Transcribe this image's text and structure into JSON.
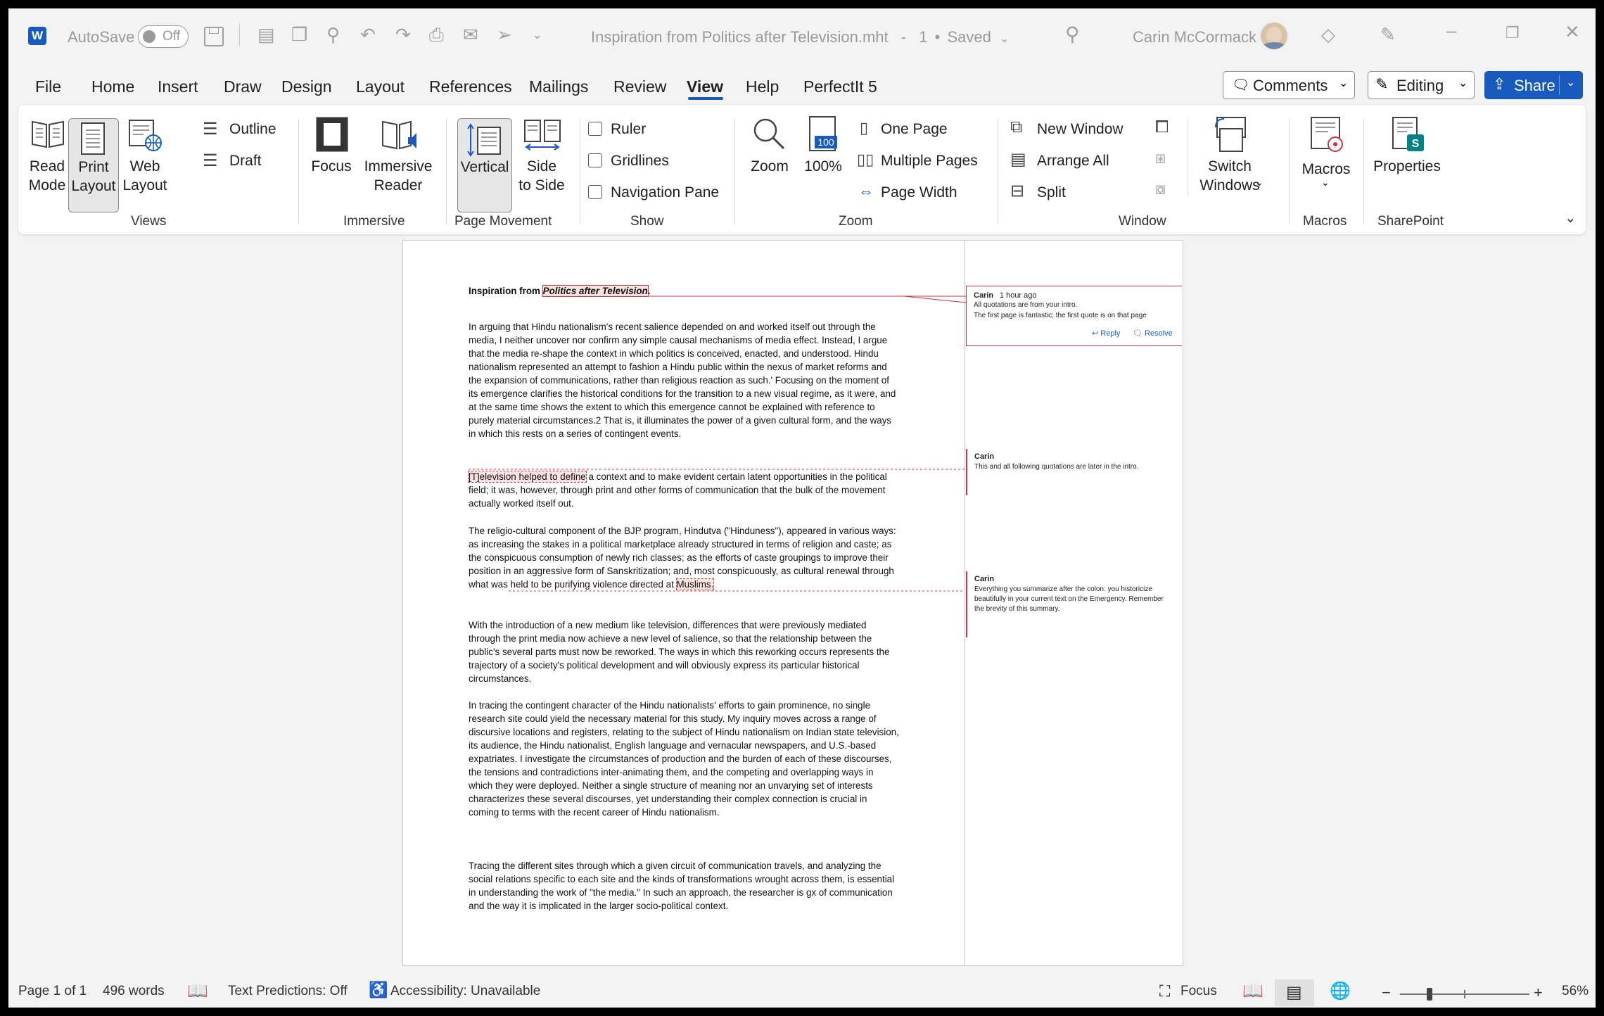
{
  "titlebar": {
    "autosave_label": "AutoSave",
    "autosave_state": "Off",
    "doc_title": "Inspiration from Politics after Television.mht",
    "sep": "-",
    "version": "1",
    "dot": "•",
    "status": "Saved",
    "user_name": "Carin McCormack"
  },
  "menu": {
    "tabs": [
      "File",
      "Home",
      "Insert",
      "Draw",
      "Design",
      "Layout",
      "References",
      "Mailings",
      "Review",
      "View",
      "Help",
      "PerfectIt 5"
    ],
    "active": "View",
    "comments_label": "Comments",
    "editing_label": "Editing",
    "share_label": "Share"
  },
  "ribbon": {
    "views": {
      "read_mode": "Read\nMode",
      "print_layout": "Print\nLayout",
      "web_layout": "Web\nLayout",
      "outline": "Outline",
      "draft": "Draft",
      "group": "Views"
    },
    "immersive": {
      "focus": "Focus",
      "reader": "Immersive\nReader",
      "group": "Immersive"
    },
    "page_movement": {
      "vertical": "Vertical",
      "side": "Side\nto Side",
      "group": "Page Movement"
    },
    "show": {
      "ruler": "Ruler",
      "gridlines": "Gridlines",
      "nav_pane": "Navigation Pane",
      "group": "Show"
    },
    "zoom": {
      "zoom": "Zoom",
      "hundred": "100%",
      "hundred_icon": "100",
      "one_page": "One Page",
      "multiple_pages": "Multiple Pages",
      "page_width": "Page Width",
      "group": "Zoom"
    },
    "window": {
      "new_window": "New Window",
      "arrange_all": "Arrange All",
      "split": "Split",
      "switch_windows": "Switch\nWindows",
      "group": "Window"
    },
    "macros": {
      "macros": "Macros",
      "group": "Macros"
    },
    "sharepoint": {
      "properties": "Properties",
      "group": "SharePoint"
    }
  },
  "document": {
    "title_prefix": "Inspiration from ",
    "title_italic": "Politics after Television",
    "title_end": ".",
    "p1": "In arguing that Hindu nationalism's recent salience depended on and worked itself out through the media, I neither uncover nor confirm any simple causal mechanisms of media effect. Instead, I argue that the media re-shape the context in which politics is conceived, enacted, and understood. Hindu nationalism represented an attempt to fashion a Hindu public within the nexus of market reforms and the expansion of communications, rather than religious reaction as such.' Focusing on the moment of its emergence clarifies the historical conditions for the transition to a new visual regime, as it were, and at the same time shows the extent to which this emergence cannot be explained with reference to purely material circumstances.2 That is, it illuminates the power of a given cultural form, and the ways in which this rests on a series of contingent events.",
    "p2_highlight": "[T]elevision helped to define",
    "p2_rest": " a context and to make evident certain latent opportunities in the political field; it was, however, through print and other forms of communication that the bulk of the movement actually worked itself out.",
    "p3_main": "The religio-cultural component of the BJP program, Hindutva (\"Hinduness\"), appeared in various ways: as increasing the stakes in a political marketplace already structured in terms of religion and caste; as the conspicuous consumption of newly rich classes; as the efforts of caste groupings to improve their position in an aggressive form of Sanskritization; and, most conspicuously, as cultural renewal through what was held to be purifying violence directed at ",
    "p3_highlight": "Muslims.",
    "p4": "With the introduction of a new medium like television, differences that were previously mediated through the print media now achieve a new level of salience, so that the relationship between the public's several parts must now be reworked. The ways in which this reworking occurs represents the trajectory of a society's political development and will obviously express its particular historical circumstances.",
    "p5": "In tracing the contingent character of the Hindu nationalists' efforts to gain prominence, no single research site could yield the necessary material for this study. My inquiry moves across a range of discursive locations and registers, relating to the subject of Hindu nationalism on Indian state television, its audience, the Hindu nationalist, English language and vernacular newspapers, and U.S.-based expatriates. I investigate the circumstances of production and the burden of each of these discourses, the tensions and contradictions inter-animating them, and the competing and overlapping ways in which they were deployed. Neither a single structure of meaning nor an unvarying set of interests characterizes these several discourses, yet understanding their complex connection is crucial in coming to terms with the recent career of Hindu nationalism.",
    "p6": "Tracing the different sites through which a given circuit of communication travels, and analyzing the social relations specific to each site and the kinds of transformations wrought across them, is essential in understanding the work of \"the media.\" In such an approach, the researcher is gx of communication and the way it is implicated in the larger socio-political context."
  },
  "comments": [
    {
      "author": "Carin",
      "time": "1 hour ago",
      "lines": [
        "All quotations are from your intro.",
        "The first page is fantastic; the first quote is on that page"
      ],
      "reply": "Reply",
      "resolve": "Resolve"
    },
    {
      "author": "Carin",
      "text": "This and all following quotations are later in the intro."
    },
    {
      "author": "Carin",
      "text": "Everything you summarize after the colon: you historicize beautifully in your current text on the Emergency. Remember the brevity of this summary."
    }
  ],
  "statusbar": {
    "page": "Page 1 of 1",
    "words": "496 words",
    "text_predictions": "Text Predictions: Off",
    "accessibility": "Accessibility: Unavailable",
    "focus": "Focus",
    "minus": "−",
    "plus": "+",
    "zoom": "56%"
  },
  "colors": {
    "accent": "#185abd",
    "share_bg": "#185abd",
    "comment_red": "#d13438",
    "word_blue": "#185abd"
  },
  "icons": [
    "word-logo-icon",
    "save-icon",
    "search-icon",
    "diamond-icon",
    "pen-icon",
    "minimize-icon",
    "restore-icon",
    "close-icon"
  ]
}
